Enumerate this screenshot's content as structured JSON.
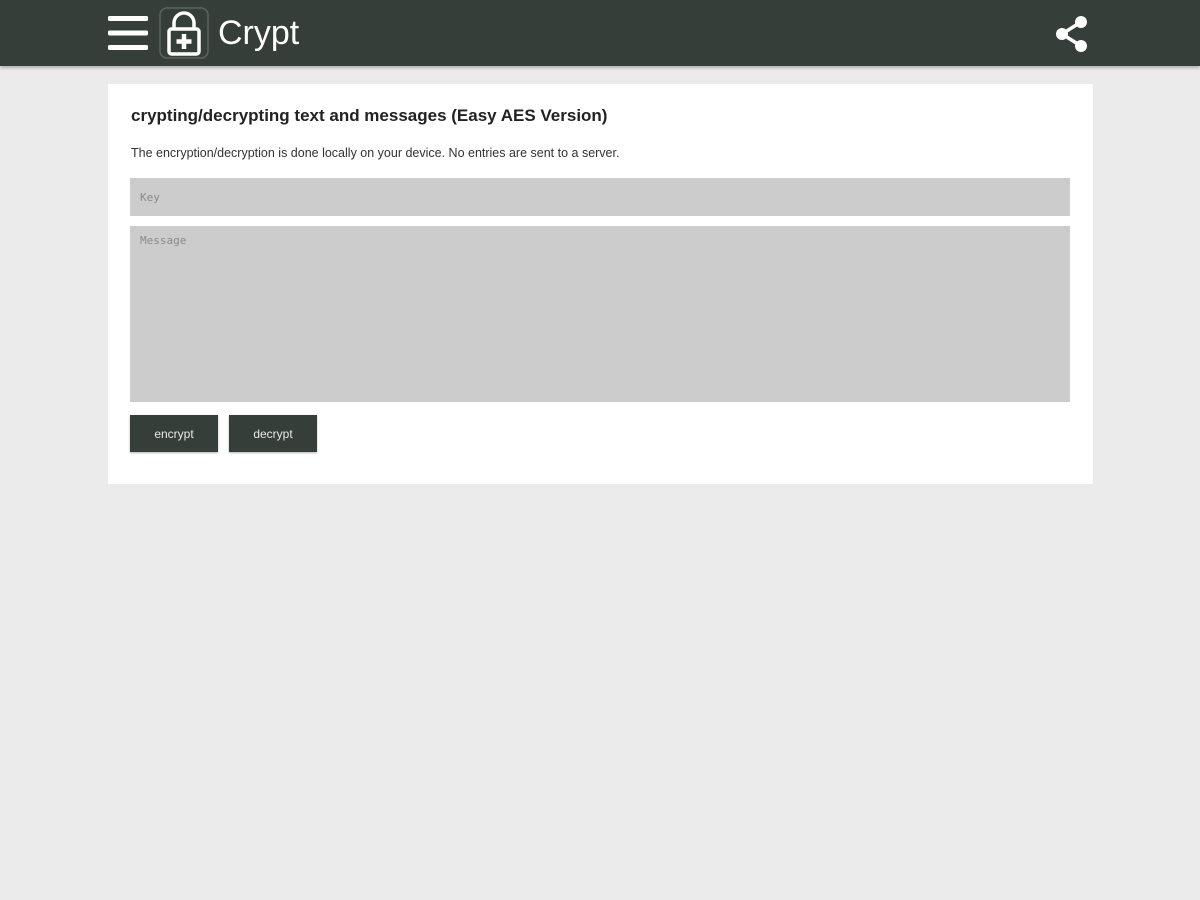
{
  "appbar": {
    "title": "Crypt",
    "background_color": "#353e39",
    "menu_icon": "hamburger-menu-icon",
    "logo_icon": "lock-plus-icon",
    "share_icon": "share-icon"
  },
  "card": {
    "title": "crypting/decrypting text and messages (Easy AES Version)",
    "description": "The encryption/decryption is done locally on your device. No entries are sent to a server.",
    "key_field": {
      "placeholder": "Key",
      "value": ""
    },
    "message_field": {
      "placeholder": "Message",
      "value": ""
    },
    "buttons": {
      "encrypt_label": "encrypt",
      "decrypt_label": "decrypt"
    }
  }
}
